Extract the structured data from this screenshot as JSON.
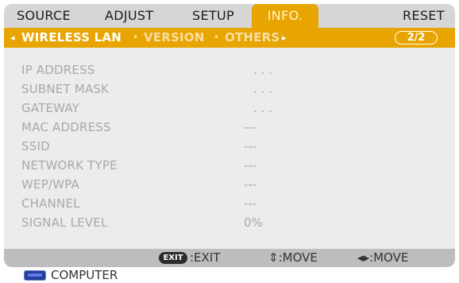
{
  "tabs": {
    "source": "SOURCE",
    "adjust": "ADJUST",
    "setup": "SETUP",
    "info": "INFO.",
    "reset": "RESET"
  },
  "subnav": {
    "left_arrow": "◂",
    "items": [
      "WIRELESS LAN",
      "VERSION",
      "OTHERS"
    ],
    "right_arrow": "▸",
    "separator": "•",
    "page": "2/2"
  },
  "rows": [
    {
      "label": "IP ADDRESS",
      "value": ".   .   ."
    },
    {
      "label": "SUBNET MASK",
      "value": ".   .   ."
    },
    {
      "label": "GATEWAY",
      "value": ".   .   ."
    },
    {
      "label": "MAC ADDRESS",
      "value": "---"
    },
    {
      "label": "SSID",
      "value": "---"
    },
    {
      "label": "NETWORK TYPE",
      "value": "---"
    },
    {
      "label": "WEP/WPA",
      "value": "---"
    },
    {
      "label": "CHANNEL",
      "value": "---"
    },
    {
      "label": "SIGNAL LEVEL",
      "value": "0%"
    }
  ],
  "footer": {
    "exit_badge": "EXIT",
    "exit_text": ":EXIT",
    "move_ud": "⇕:MOVE",
    "move_lr": "◂▸:MOVE"
  },
  "source": {
    "label": "COMPUTER",
    "icon": "computer-input-icon"
  },
  "colors": {
    "accent": "#e8a400",
    "panel": "#ececec",
    "tabbar": "#d6d6d6",
    "footer": "#bdbdbd",
    "label": "#a8a8a8"
  }
}
